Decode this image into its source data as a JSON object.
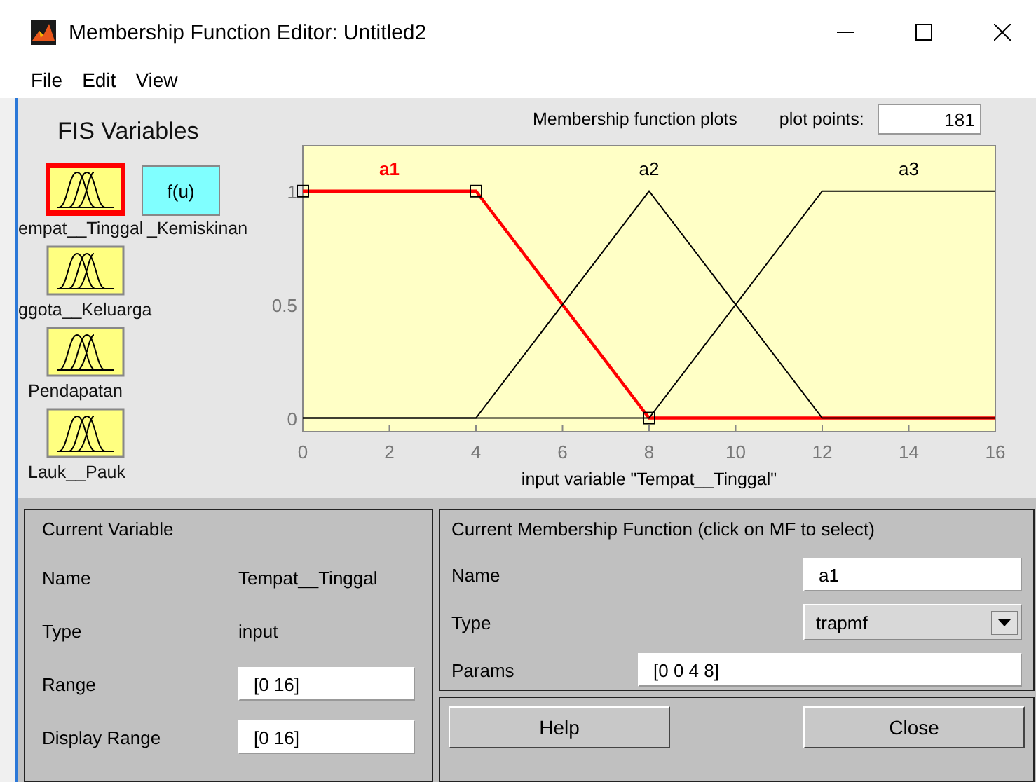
{
  "window": {
    "title": "Membership Function Editor: Untitled2"
  },
  "menu": [
    "File",
    "Edit",
    "View"
  ],
  "fis_variables": {
    "title": "FIS Variables",
    "items": [
      {
        "kind": "input",
        "label": "empat__Tinggal",
        "selected": true
      },
      {
        "kind": "output",
        "symbol": "f(u)",
        "label": "_Kemiskinan",
        "selected": false
      },
      {
        "kind": "input",
        "label": "ggota__Keluarga",
        "selected": false
      },
      {
        "kind": "input",
        "label": "Pendapatan",
        "selected": false
      },
      {
        "kind": "input",
        "label": "Lauk__Pauk",
        "selected": false
      }
    ]
  },
  "plot": {
    "title": "Membership function plots",
    "plot_points_label": "plot points:",
    "plot_points": "181",
    "chart_data": {
      "type": "line",
      "xlabel": "input variable \"Tempat__Tinggal\"",
      "x": [
        0,
        4,
        8,
        12,
        16
      ],
      "series": [
        {
          "name": "a1",
          "color": "#ff0000",
          "values": [
            1,
            1,
            0,
            0,
            0
          ]
        },
        {
          "name": "a2",
          "color": "#000000",
          "values": [
            0,
            0,
            1,
            0,
            0
          ]
        },
        {
          "name": "a3",
          "color": "#000000",
          "values": [
            0,
            0,
            0,
            1,
            1
          ]
        }
      ],
      "xlim": [
        0,
        16
      ],
      "ylim": [
        -0.06,
        1.2
      ],
      "xticks": [
        0,
        2,
        4,
        6,
        8,
        10,
        12,
        14,
        16
      ],
      "yticks": [
        0,
        0.5,
        1
      ]
    },
    "membership_functions": [
      {
        "selected": true
      },
      {
        "selected": false
      },
      {
        "selected": false
      }
    ]
  },
  "current_variable": {
    "title": "Current Variable",
    "name_label": "Name",
    "name": "Tempat__Tinggal",
    "type_label": "Type",
    "type": "input",
    "range_label": "Range",
    "range": "[0 16]",
    "display_range_label": "Display Range",
    "display_range": "[0 16]"
  },
  "current_mf": {
    "title": "Current Membership Function (click on MF to select)",
    "name_label": "Name",
    "name": "a1",
    "type_label": "Type",
    "type": "trapmf",
    "params_label": "Params",
    "params": "[0 0 4 8]"
  },
  "buttons": [
    "Help",
    "Close"
  ]
}
